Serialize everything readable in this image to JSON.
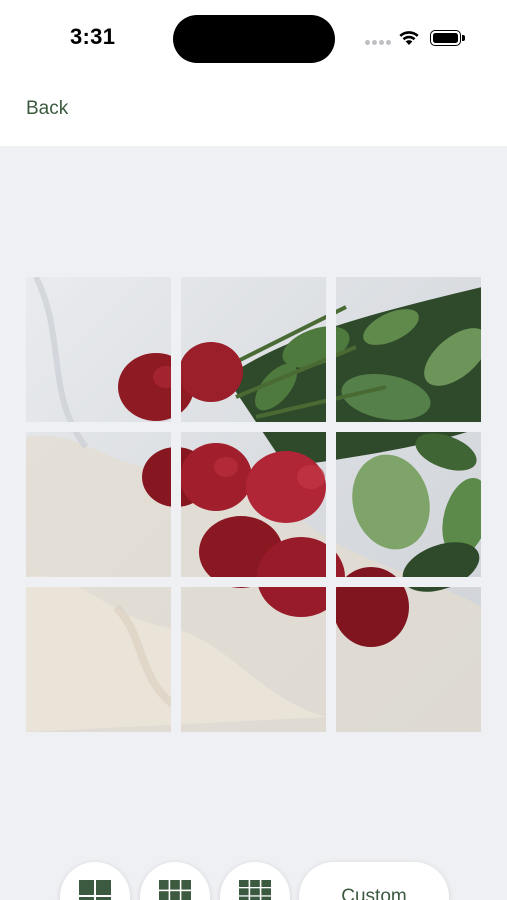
{
  "status_bar": {
    "time": "3:31",
    "icons": [
      "signal-icon",
      "wifi-icon",
      "battery-icon"
    ]
  },
  "nav": {
    "back_label": "Back"
  },
  "grid": {
    "rows": 3,
    "columns": 3,
    "image_subject": "rose-bouquet-photo"
  },
  "toolbar": {
    "options": [
      {
        "icon": "grid-2x2-icon"
      },
      {
        "icon": "grid-3x3-icon"
      },
      {
        "icon": "grid-3x4-icon"
      }
    ],
    "custom_label": "Custom"
  },
  "colors": {
    "accent": "#3b5a3f",
    "background": "#eff0f3",
    "rose": "#8e1a24",
    "leaf": "#4f7a3e"
  }
}
